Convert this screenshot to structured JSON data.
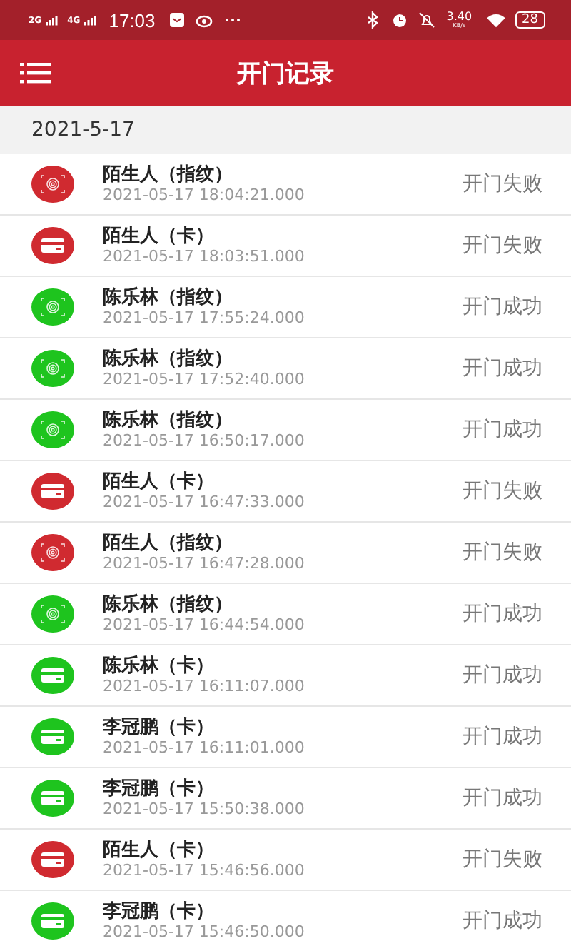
{
  "status_bar": {
    "network_1": "2G",
    "network_2": "4G",
    "time": "17:03",
    "speed": "3.40",
    "speed_unit": "KB/s",
    "battery": "28"
  },
  "header": {
    "title": "开门记录"
  },
  "date_header": "2021-5-17",
  "records": [
    {
      "name": "陌生人（指纹）",
      "time": "2021-05-17 18:04:21.000",
      "result": "开门失败",
      "kind": "fingerprint",
      "success": false
    },
    {
      "name": "陌生人（卡）",
      "time": "2021-05-17 18:03:51.000",
      "result": "开门失败",
      "kind": "card",
      "success": false
    },
    {
      "name": "陈乐林（指纹）",
      "time": "2021-05-17 17:55:24.000",
      "result": "开门成功",
      "kind": "fingerprint",
      "success": true
    },
    {
      "name": "陈乐林（指纹）",
      "time": "2021-05-17 17:52:40.000",
      "result": "开门成功",
      "kind": "fingerprint",
      "success": true
    },
    {
      "name": "陈乐林（指纹）",
      "time": "2021-05-17 16:50:17.000",
      "result": "开门成功",
      "kind": "fingerprint",
      "success": true
    },
    {
      "name": "陌生人（卡）",
      "time": "2021-05-17 16:47:33.000",
      "result": "开门失败",
      "kind": "card",
      "success": false
    },
    {
      "name": "陌生人（指纹）",
      "time": "2021-05-17 16:47:28.000",
      "result": "开门失败",
      "kind": "fingerprint",
      "success": false
    },
    {
      "name": "陈乐林（指纹）",
      "time": "2021-05-17 16:44:54.000",
      "result": "开门成功",
      "kind": "fingerprint",
      "success": true
    },
    {
      "name": "陈乐林（卡）",
      "time": "2021-05-17 16:11:07.000",
      "result": "开门成功",
      "kind": "card",
      "success": true
    },
    {
      "name": "李冠鹏（卡）",
      "time": "2021-05-17 16:11:01.000",
      "result": "开门成功",
      "kind": "card",
      "success": true
    },
    {
      "name": "李冠鹏（卡）",
      "time": "2021-05-17 15:50:38.000",
      "result": "开门成功",
      "kind": "card",
      "success": true
    },
    {
      "name": "陌生人（卡）",
      "time": "2021-05-17 15:46:56.000",
      "result": "开门失败",
      "kind": "card",
      "success": false
    },
    {
      "name": "李冠鹏（卡）",
      "time": "2021-05-17 15:46:50.000",
      "result": "开门成功",
      "kind": "card",
      "success": true
    }
  ]
}
